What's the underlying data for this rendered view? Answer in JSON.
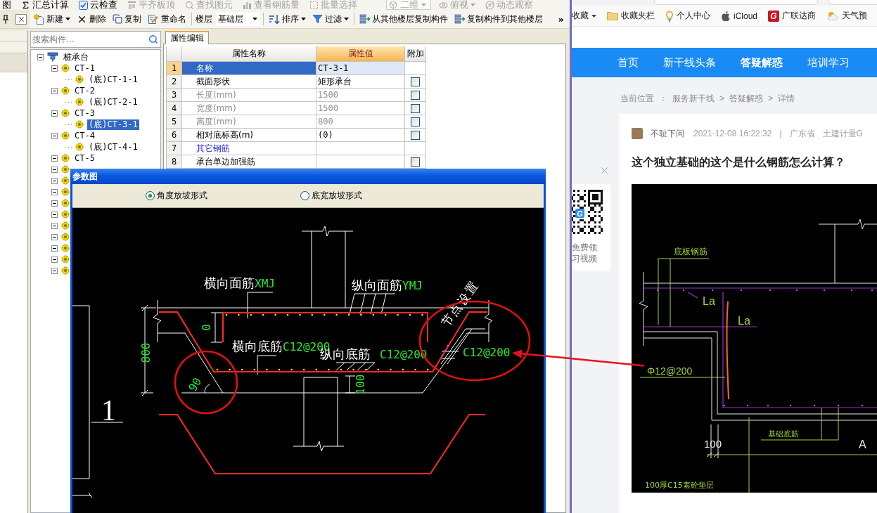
{
  "app": {
    "top_toolbar": [
      {
        "kind": "button",
        "label": "图",
        "disabled": false,
        "dropdown": false
      },
      {
        "kind": "button",
        "label": "汇总计算",
        "disabled": false,
        "dropdown": false
      },
      {
        "kind": "button",
        "label": "云检查",
        "disabled": false,
        "dropdown": false
      },
      {
        "kind": "button",
        "label": "平齐板顶",
        "disabled": true,
        "dropdown": false
      },
      {
        "kind": "button",
        "label": "查找图元",
        "disabled": true,
        "dropdown": false
      },
      {
        "kind": "button",
        "label": "查看钢筋量",
        "disabled": true,
        "dropdown": false
      },
      {
        "kind": "button",
        "label": "批量选择",
        "disabled": true,
        "dropdown": false
      },
      {
        "kind": "combo",
        "label": "二维",
        "disabled": true,
        "dropdown": true
      },
      {
        "kind": "button",
        "label": "俯视",
        "disabled": true,
        "dropdown": true
      },
      {
        "kind": "button",
        "label": "动态观察",
        "disabled": true,
        "dropdown": false
      }
    ],
    "main_toolbar": {
      "items": [
        {
          "kind": "button",
          "label": "新建",
          "dropdown": true
        },
        {
          "kind": "button",
          "label": "删除",
          "dropdown": false
        },
        {
          "kind": "button",
          "label": "复制",
          "dropdown": false
        },
        {
          "kind": "button",
          "label": "重命名",
          "dropdown": false
        },
        {
          "kind": "separator"
        },
        {
          "kind": "label",
          "label": "楼层"
        },
        {
          "kind": "combo",
          "label": "基础层",
          "dropdown": true
        },
        {
          "kind": "separator"
        },
        {
          "kind": "button",
          "label": "排序",
          "dropdown": true
        },
        {
          "kind": "button",
          "label": "过滤",
          "dropdown": true
        },
        {
          "kind": "separator"
        },
        {
          "kind": "button",
          "label": "从其他楼层复制构件",
          "dropdown": false
        },
        {
          "kind": "button",
          "label": "复制构件到其他楼层",
          "dropdown": false
        }
      ],
      "overflow": "»"
    },
    "component_search": {
      "placeholder": "搜索构件..."
    },
    "tree": [
      {
        "label": "桩承台",
        "expanded": true,
        "selected": false,
        "children": [
          {
            "label": "CT-1",
            "expanded": true,
            "selected": false,
            "children": [
              {
                "label": "(底)CT-1-1",
                "selected": false
              }
            ]
          },
          {
            "label": "CT-2",
            "expanded": true,
            "selected": false,
            "children": [
              {
                "label": "(底)CT-2-1",
                "selected": false
              }
            ]
          },
          {
            "label": "CT-3",
            "expanded": true,
            "selected": false,
            "children": [
              {
                "label": "(底)CT-3-1",
                "selected": true
              }
            ]
          },
          {
            "label": "CT-4",
            "expanded": true,
            "selected": false,
            "children": [
              {
                "label": "(底)CT-4-1",
                "selected": false
              }
            ]
          },
          {
            "label": "CT-5",
            "expanded": true,
            "selected": false
          },
          {
            "expanded": true
          },
          {
            "expanded": true
          },
          {
            "expanded": true
          },
          {
            "expanded": true
          },
          {
            "expanded": true
          },
          {
            "expanded": true
          },
          {
            "expanded": true
          },
          {
            "expanded": true
          },
          {
            "expanded": true
          },
          {
            "expanded": true
          }
        ]
      }
    ],
    "properties": {
      "tabs": [
        {
          "label": "属性编辑",
          "selected": true
        }
      ],
      "columns": [
        {
          "label": "属性名称",
          "selected": false
        },
        {
          "label": "属性值",
          "selected": true
        },
        {
          "label": "附加",
          "selected": false
        }
      ],
      "rows": [
        {
          "number": "1",
          "name": "名称",
          "value": "CT-3-1",
          "kind": "editable",
          "selected": true
        },
        {
          "number": "2",
          "name": "截面形状",
          "value": "矩形承台",
          "kind": "editable",
          "selected": false,
          "checked": false
        },
        {
          "number": "3",
          "name": "长度(mm)",
          "value": "1500",
          "kind": "readonly",
          "selected": false,
          "checked": false
        },
        {
          "number": "4",
          "name": "宽度(mm)",
          "value": "1500",
          "kind": "readonly",
          "selected": false,
          "checked": false
        },
        {
          "number": "5",
          "name": "高度(mm)",
          "value": "800",
          "kind": "readonly",
          "selected": false,
          "checked": false
        },
        {
          "number": "6",
          "name": "相对底标高(m)",
          "value": "(0)",
          "kind": "editable",
          "selected": false,
          "checked": false
        },
        {
          "number": "7",
          "name": "其它钢筋",
          "kind": "group",
          "selected": false
        },
        {
          "number": "8",
          "name": "承台单边加强筋",
          "kind": "editable",
          "selected": false,
          "checked": false
        }
      ]
    }
  },
  "dialog": {
    "title": "参数图",
    "options": [
      {
        "label": "角度放坡形式",
        "selected": true
      },
      {
        "label": "底宽放坡形式",
        "selected": false
      }
    ],
    "drawing": {
      "top_x_rebar": {
        "name": "横向面筋",
        "code": "XMJ"
      },
      "top_y_rebar": {
        "name": "纵向面筋",
        "code": "YMJ"
      },
      "bottom_x_rebar": {
        "name": "横向底筋",
        "code": "C12@200"
      },
      "bottom_y_rebar": {
        "name": "纵向底筋",
        "code": "C12@200"
      },
      "node_setting": "节点设置",
      "node_rebar": "C12@200",
      "height_dim": "800",
      "top_cover_dim": "0",
      "bottom_cover_dim": "100",
      "slope_angle": "90",
      "section_mark": "1"
    }
  },
  "browser": {
    "bookmarks": [
      {
        "label": "收藏",
        "dropdown": true
      },
      {
        "label": "收藏夹栏",
        "dropdown": false
      },
      {
        "label": "个人中心",
        "dropdown": false
      },
      {
        "label": "iCloud",
        "dropdown": false
      },
      {
        "label": "广联达商",
        "dropdown": false,
        "logo": "G"
      },
      {
        "label": "天气预",
        "dropdown": false
      }
    ],
    "nav": [
      {
        "label": "首页",
        "selected": false
      },
      {
        "label": "新干线头条",
        "selected": false
      },
      {
        "label": "答疑解惑",
        "selected": true
      },
      {
        "label": "培训学习",
        "selected": false
      }
    ],
    "breadcrumb": {
      "label": "当前位置",
      "colon": "：",
      "path": [
        {
          "text": "服务新干线"
        },
        {
          "sep": ">",
          "text": "答疑解惑"
        },
        {
          "sep": ">",
          "text": "详情"
        }
      ]
    },
    "promo": {
      "qr_logo": "G",
      "lines": [
        "免费领",
        "习视频"
      ]
    },
    "post": {
      "author": "不耻下问",
      "time": "2021-12-08 16:22:32",
      "divider": "|",
      "region": "广东省",
      "category": "土建计量G",
      "title": "这个独立基础的这个是什么钢筋怎么计算？",
      "image": {
        "slab_rebar": "底板钢筋",
        "anchor_1": "La",
        "anchor_2": "La",
        "rebar_spec": "Φ12@200",
        "base_rebar": "基础底筋",
        "cushion_thickness": "100",
        "axis": "A",
        "cushion_note": "100厚C15素砼垫层"
      }
    }
  }
}
